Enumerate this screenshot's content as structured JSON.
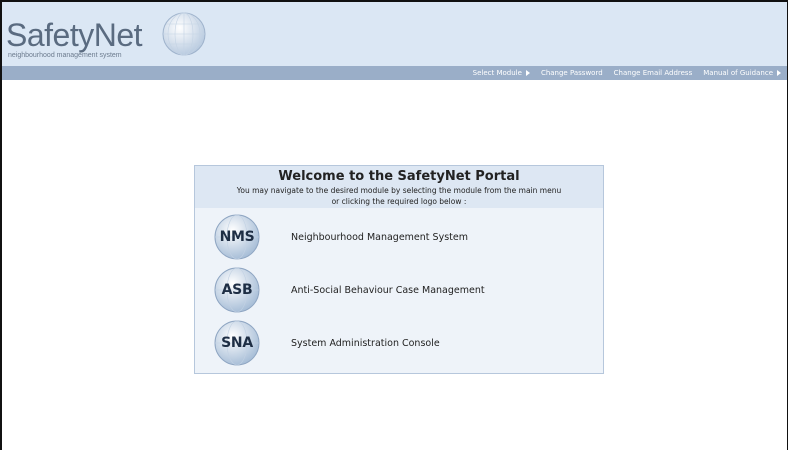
{
  "header": {
    "logo_text": "SafetyNet",
    "logo_subtitle": "neighbourhood management system",
    "colors": {
      "header_bg": "#dbe7f4",
      "navbar_bg": "#9aaec8"
    }
  },
  "nav": {
    "items": [
      {
        "label": "Select Module",
        "icon": "triangle-right-icon"
      },
      {
        "label": "Change Password"
      },
      {
        "label": "Change Email Address"
      },
      {
        "label": "Manual of Guidance",
        "icon": "triangle-right-icon"
      }
    ]
  },
  "welcome": {
    "title": "Welcome to the SafetyNet Portal",
    "desc_line1": "You may navigate to the desired module by selecting the module from the main menu",
    "desc_line2": "or clicking the required logo below  :"
  },
  "modules": [
    {
      "abbr": "NMS",
      "label": "Neighbourhood Management System"
    },
    {
      "abbr": "ASB",
      "label": "Anti-Social Behaviour Case Management"
    },
    {
      "abbr": "SNA",
      "label": "System Administration Console"
    }
  ]
}
